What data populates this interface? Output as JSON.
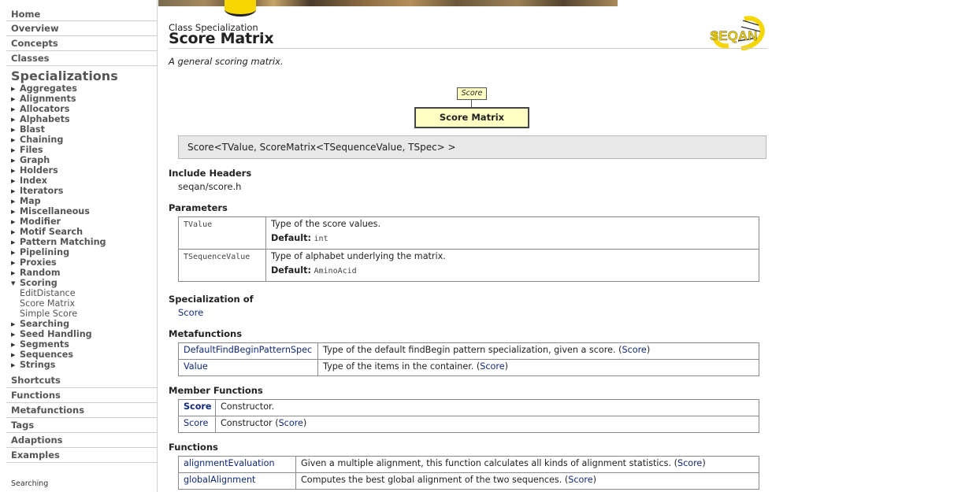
{
  "sidebar": {
    "top_nav": [
      {
        "name": "nav-home",
        "label": "Home"
      },
      {
        "name": "nav-overview",
        "label": "Overview"
      },
      {
        "name": "nav-concepts",
        "label": "Concepts"
      },
      {
        "name": "nav-classes",
        "label": "Classes"
      }
    ],
    "specializations_heading": "Specializations",
    "specializations": [
      "Aggregates",
      "Alignments",
      "Allocators",
      "Alphabets",
      "Blast",
      "Chaining",
      "Files",
      "Graph",
      "Holders",
      "Index",
      "Iterators",
      "Map",
      "Miscellaneous",
      "Modifier",
      "Motif Search",
      "Pattern Matching",
      "Pipelining",
      "Proxies",
      "Random"
    ],
    "expanded": {
      "label": "Scoring",
      "children": [
        "EditDistance",
        "Score Matrix",
        "Simple Score"
      ]
    },
    "specializations_after": [
      "Searching",
      "Seed Handling",
      "Segments",
      "Sequences",
      "Strings"
    ],
    "lower_nav": [
      {
        "name": "nav-shortcuts",
        "label": "Shortcuts"
      },
      {
        "name": "nav-functions",
        "label": "Functions"
      },
      {
        "name": "nav-metafunctions",
        "label": "Metafunctions"
      },
      {
        "name": "nav-tags",
        "label": "Tags"
      },
      {
        "name": "nav-adaptions",
        "label": "Adaptions"
      },
      {
        "name": "nav-examples",
        "label": "Examples"
      }
    ],
    "search_label": "Searching"
  },
  "header": {
    "kind": "Class Specialization",
    "title": "Score Matrix",
    "logo_text": "SEQAN",
    "summary": "A general scoring matrix."
  },
  "diagram": {
    "parent": "Score",
    "self": "Score Matrix"
  },
  "signature": "Score<TValue, ScoreMatrix<TSequenceValue, TSpec> >",
  "include": {
    "heading": "Include Headers",
    "value": "seqan/score.h"
  },
  "parameters": {
    "heading": "Parameters",
    "default_label": "Default:",
    "rows": [
      {
        "name": "TValue",
        "desc": "Type of the score values.",
        "default": "int"
      },
      {
        "name": "TSequenceValue",
        "desc": "Type of alphabet underlying the matrix.",
        "default": "AminoAcid"
      }
    ]
  },
  "specialization_of": {
    "heading": "Specialization of",
    "value": "Score"
  },
  "metafunctions": {
    "heading": "Metafunctions",
    "rows": [
      {
        "name": "DefaultFindBeginPatternSpec",
        "desc": "Type of the default findBegin pattern specialization, given a score. (",
        "ref": "Score",
        "close": ")"
      },
      {
        "name": "Value",
        "desc": "Type of the items in the container. (",
        "ref": "Score",
        "close": ")"
      }
    ]
  },
  "member_functions": {
    "heading": "Member Functions",
    "rows": [
      {
        "name": "Score",
        "desc": "Constructor.",
        "ref": "",
        "close": ""
      },
      {
        "name": "Score",
        "desc": "Constructor (",
        "ref": "Score",
        "close": ")"
      }
    ]
  },
  "functions": {
    "heading": "Functions",
    "rows": [
      {
        "name": "alignmentEvaluation",
        "desc": "Given a multiple alignment, this function calculates all kinds of alignment statistics. (",
        "ref": "Score",
        "close": ")"
      },
      {
        "name": "globalAlignment",
        "desc": "Computes the best global alignment of the two sequences. (",
        "ref": "Score",
        "close": ")"
      }
    ]
  },
  "colors": {
    "link": "#102a7a",
    "diagram_fill": "#ffffc4",
    "logo_yellow": "#f6d600"
  }
}
